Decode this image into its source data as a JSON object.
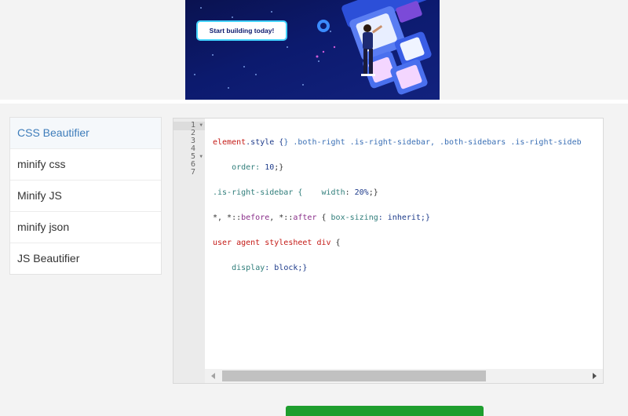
{
  "banner": {
    "cta_label": "Start building today!"
  },
  "sidebar": {
    "items": [
      {
        "label": "CSS Beautifier",
        "active": true
      },
      {
        "label": "minify css",
        "active": false
      },
      {
        "label": "Minify JS",
        "active": false
      },
      {
        "label": "minify json",
        "active": false
      },
      {
        "label": "JS Beautifier",
        "active": false
      }
    ]
  },
  "editor": {
    "line_numbers": [
      "1",
      "2",
      "3",
      "4",
      "5",
      "6",
      "7"
    ],
    "code": {
      "l1_a": "element",
      "l1_b": ".style {",
      "l1_c": "} .both-right .is-right-sidebar, .both-sidebars .is-right-sideb",
      "l2_a": "    order: ",
      "l2_b": "10",
      "l2_c": ";}",
      "l3_a": ".is-right-sidebar {    ",
      "l3_b": "width",
      "l3_c": ": ",
      "l3_d": "20%",
      "l3_e": ";}",
      "l4_a": "*, *::",
      "l4_b": "before",
      "l4_c": ", *::",
      "l4_d": "after",
      "l4_e": " { ",
      "l4_f": "box-sizing",
      "l4_g": ": inherit;}",
      "l5_a": "user agent stylesheet div",
      "l5_b": " {",
      "l6_a": "    ",
      "l6_b": "display",
      "l6_c": ": block;}"
    }
  },
  "colors": {
    "accent": "#3d7cba",
    "button_green": "#1e9e2e"
  }
}
